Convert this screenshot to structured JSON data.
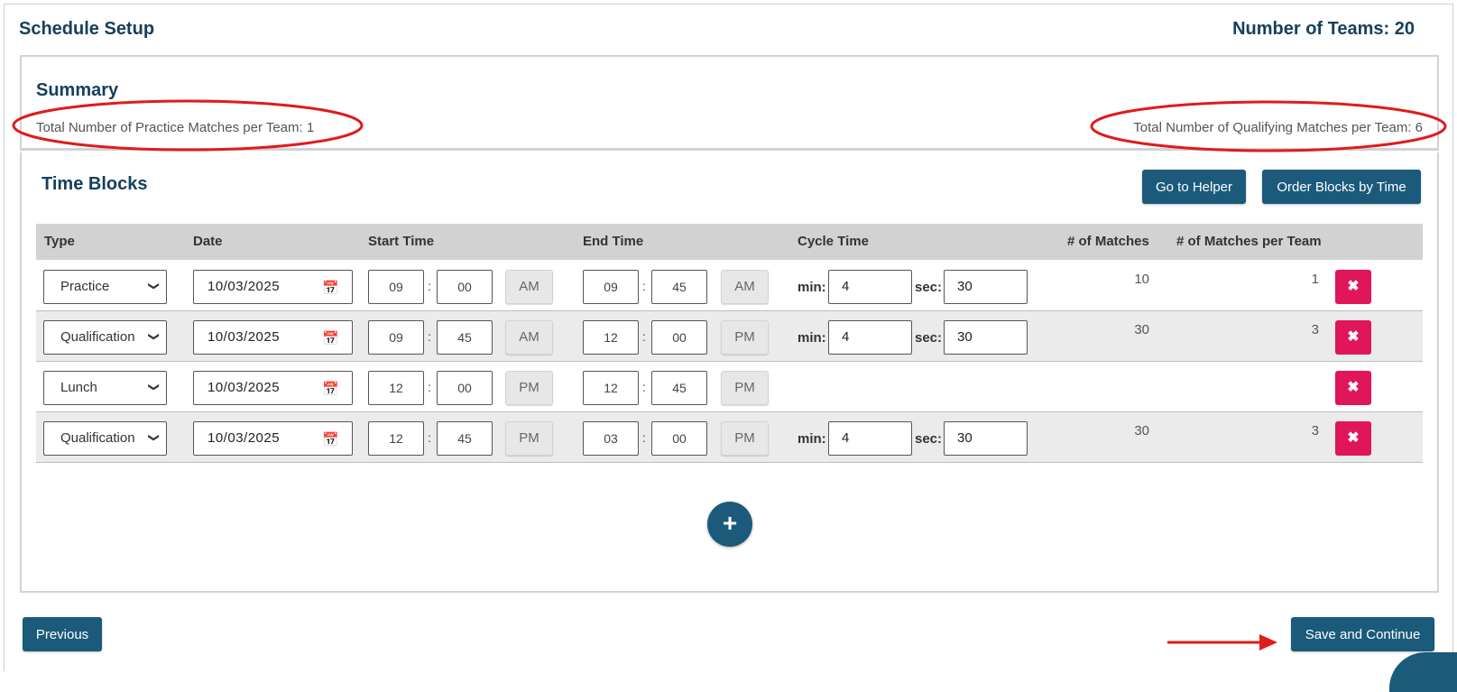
{
  "header": {
    "title": "Schedule Setup",
    "team_count_label": "Number of Teams:",
    "team_count": "20"
  },
  "summary": {
    "title": "Summary",
    "practice_label": "Total Number of Practice Matches per Team:",
    "practice_value": "1",
    "qual_label": "Total Number of Qualifying Matches per Team:",
    "qual_value": "6"
  },
  "time_blocks": {
    "title": "Time Blocks",
    "helper_button": "Go to Helper",
    "order_button": "Order Blocks by Time",
    "columns": [
      "Type",
      "Date",
      "Start Time",
      "End Time",
      "Cycle Time",
      "# of Matches",
      "# of Matches per Team"
    ],
    "min_label": "min:",
    "sec_label": "sec:",
    "colon": ":",
    "delete_glyph": "✖",
    "rows": [
      {
        "type": "Practice",
        "date": "10/03/2025",
        "start_h": "09",
        "start_m": "00",
        "start_ampm": "AM",
        "end_h": "09",
        "end_m": "45",
        "end_ampm": "AM",
        "min": "4",
        "sec": "30",
        "matches": "10",
        "per_team": "1"
      },
      {
        "type": "Qualification",
        "date": "10/03/2025",
        "start_h": "09",
        "start_m": "45",
        "start_ampm": "AM",
        "end_h": "12",
        "end_m": "00",
        "end_ampm": "PM",
        "min": "4",
        "sec": "30",
        "matches": "30",
        "per_team": "3"
      },
      {
        "type": "Lunch",
        "date": "10/03/2025",
        "start_h": "12",
        "start_m": "00",
        "start_ampm": "PM",
        "end_h": "12",
        "end_m": "45",
        "end_ampm": "PM"
      },
      {
        "type": "Qualification",
        "date": "10/03/2025",
        "start_h": "12",
        "start_m": "45",
        "start_ampm": "PM",
        "end_h": "03",
        "end_m": "00",
        "end_ampm": "PM",
        "min": "4",
        "sec": "30",
        "matches": "30",
        "per_team": "3"
      }
    ],
    "add_glyph": "+"
  },
  "footer": {
    "previous_button": "Previous",
    "save_button": "Save and Continue"
  },
  "colors": {
    "primary": "#1b5a7a",
    "title": "#16405c",
    "delete": "#e0155a",
    "annotation": "#e01b1b"
  },
  "icons": {
    "dropdown": "chevron-down-icon",
    "calendar": "calendar-icon",
    "delete": "close-icon",
    "add": "plus-icon",
    "annotation_arrow": "arrow-right-icon"
  }
}
